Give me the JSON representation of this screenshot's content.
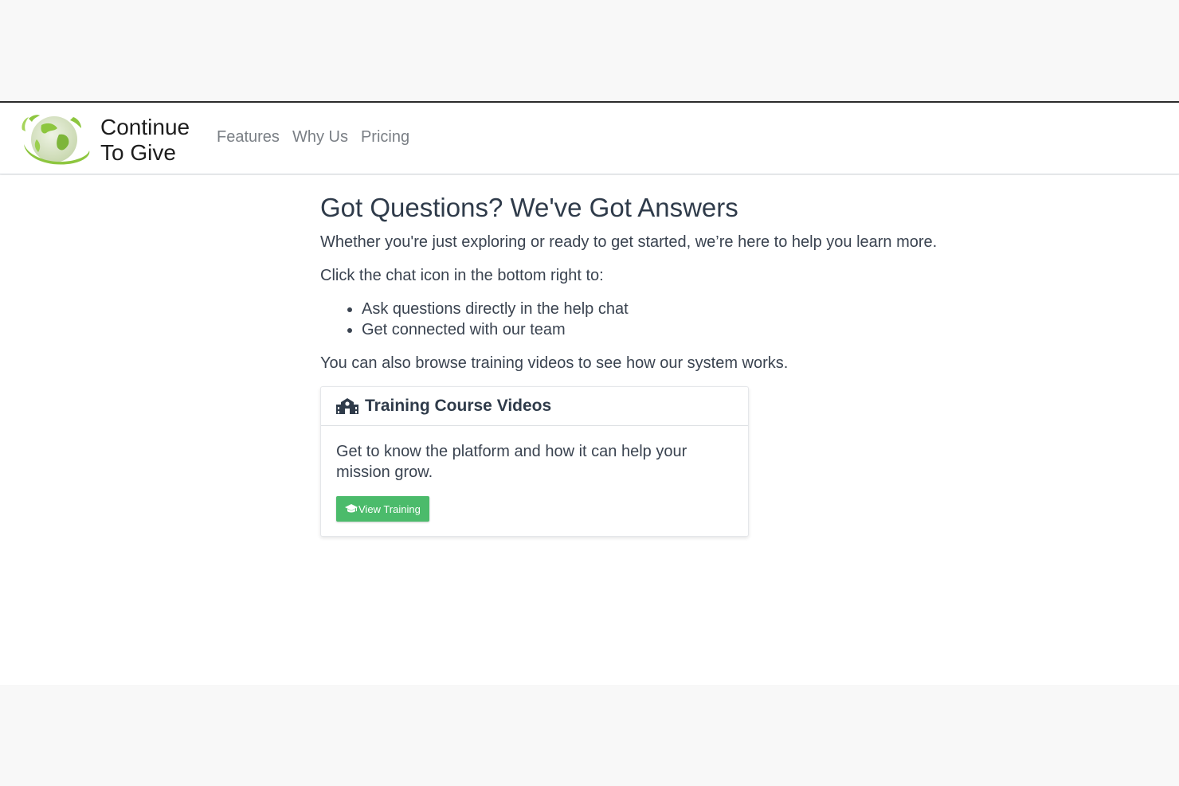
{
  "brand": {
    "name_line1": "Continue",
    "name_line2": "To Give"
  },
  "nav": {
    "items": [
      {
        "label": "Features"
      },
      {
        "label": "Why Us"
      },
      {
        "label": "Pricing"
      }
    ]
  },
  "main": {
    "heading": "Got Questions? We've Got Answers",
    "intro": "Whether you're just exploring or ready to get started, we’re here to help you learn more.",
    "click_text": "Click the chat icon in the bottom right to:",
    "bullets": [
      "Ask questions directly in the help chat",
      "Get connected with our team"
    ],
    "browse_text": "You can also browse training videos to see how our system works."
  },
  "card": {
    "icon": "school-icon",
    "title": "Training Course Videos",
    "body": "Get to know the platform and how it can help your mission grow.",
    "button_icon": "graduation-cap-icon",
    "button_label": "View Training"
  },
  "colors": {
    "accent_green": "#4bbb6b",
    "logo_green": "#8dc63f",
    "heading": "#2f3b4a",
    "nav_text": "#7a7f85"
  }
}
